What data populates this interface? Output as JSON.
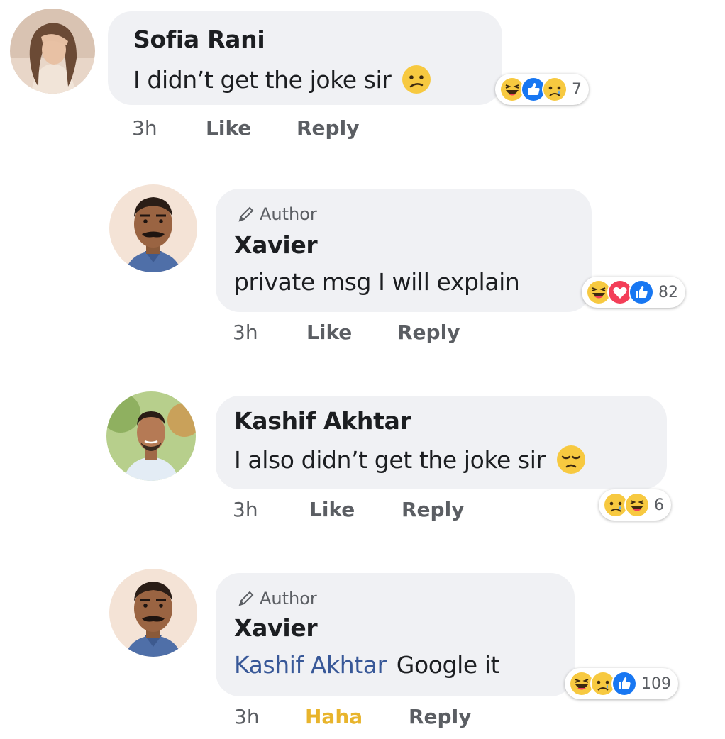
{
  "comments": [
    {
      "name": "Sofia Rani",
      "author_tag": "",
      "text": "I didn’t get the joke sir",
      "mention": "",
      "inline_emoji": "confused-emoji",
      "reactions": [
        "haha",
        "like",
        "sad"
      ],
      "reaction_count": "7",
      "time": "3h",
      "like_label": "Like",
      "reply_label": "Reply"
    },
    {
      "name": "Xavier",
      "author_tag": "Author",
      "text": "private msg I will explain",
      "mention": "",
      "inline_emoji": "",
      "reactions": [
        "haha",
        "love",
        "like"
      ],
      "reaction_count": "82",
      "time": "3h",
      "like_label": "Like",
      "reply_label": "Reply"
    },
    {
      "name": "Kashif Akhtar",
      "author_tag": "",
      "text": "I also didn’t get the joke sir",
      "mention": "",
      "inline_emoji": "pensive-emoji",
      "reactions": [
        "sad",
        "haha"
      ],
      "reaction_count": "6",
      "time": "3h",
      "like_label": "Like",
      "reply_label": "Reply"
    },
    {
      "name": "Xavier",
      "author_tag": "Author",
      "text": "Google it",
      "mention": "Kashif Akhtar",
      "inline_emoji": "",
      "reactions": [
        "haha",
        "sad",
        "like"
      ],
      "reaction_count": "109",
      "time": "3h",
      "like_label": "Haha",
      "reply_label": "Reply"
    }
  ],
  "colors": {
    "bubble": "#f0f1f4",
    "like_blue": "#1877f2",
    "love_red": "#f33e58",
    "haha_yellow": "#f7c940",
    "haha_label": "#e8b42c",
    "mention": "#385898"
  }
}
